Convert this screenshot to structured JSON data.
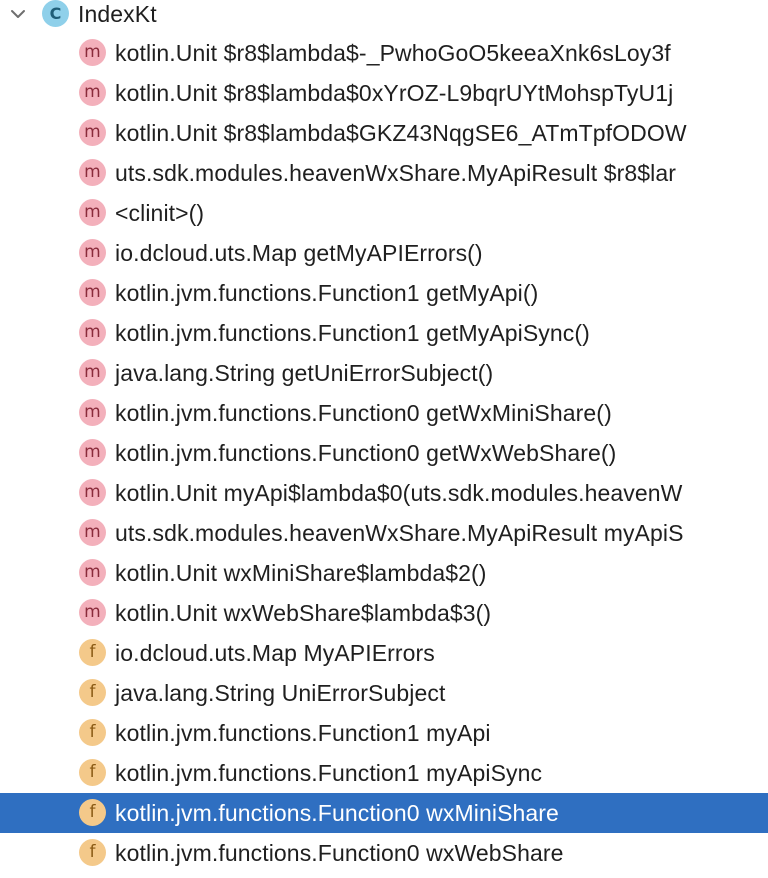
{
  "tree": {
    "root": {
      "label": "IndexKt",
      "icon": "class-icon",
      "icon_letter": "C",
      "expanded": true
    },
    "members": [
      {
        "kind": "method",
        "letter": "m",
        "label": "kotlin.Unit $r8$lambda$-_PwhoGoO5keeaXnk6sLoy3f"
      },
      {
        "kind": "method",
        "letter": "m",
        "label": "kotlin.Unit $r8$lambda$0xYrOZ-L9bqrUYtMohspTyU1j"
      },
      {
        "kind": "method",
        "letter": "m",
        "label": "kotlin.Unit $r8$lambda$GKZ43NqgSE6_ATmTpfODOW"
      },
      {
        "kind": "method",
        "letter": "m",
        "label": "uts.sdk.modules.heavenWxShare.MyApiResult $r8$lar"
      },
      {
        "kind": "method",
        "letter": "m",
        "label": "<clinit>()"
      },
      {
        "kind": "method",
        "letter": "m",
        "label": "io.dcloud.uts.Map getMyAPIErrors()"
      },
      {
        "kind": "method",
        "letter": "m",
        "label": "kotlin.jvm.functions.Function1 getMyApi()"
      },
      {
        "kind": "method",
        "letter": "m",
        "label": "kotlin.jvm.functions.Function1 getMyApiSync()"
      },
      {
        "kind": "method",
        "letter": "m",
        "label": "java.lang.String getUniErrorSubject()"
      },
      {
        "kind": "method",
        "letter": "m",
        "label": "kotlin.jvm.functions.Function0 getWxMiniShare()"
      },
      {
        "kind": "method",
        "letter": "m",
        "label": "kotlin.jvm.functions.Function0 getWxWebShare()"
      },
      {
        "kind": "method",
        "letter": "m",
        "label": "kotlin.Unit myApi$lambda$0(uts.sdk.modules.heavenW"
      },
      {
        "kind": "method",
        "letter": "m",
        "label": "uts.sdk.modules.heavenWxShare.MyApiResult myApiS"
      },
      {
        "kind": "method",
        "letter": "m",
        "label": "kotlin.Unit wxMiniShare$lambda$2()"
      },
      {
        "kind": "method",
        "letter": "m",
        "label": "kotlin.Unit wxWebShare$lambda$3()"
      },
      {
        "kind": "field",
        "letter": "f",
        "label": "io.dcloud.uts.Map MyAPIErrors"
      },
      {
        "kind": "field",
        "letter": "f",
        "label": "java.lang.String UniErrorSubject"
      },
      {
        "kind": "field",
        "letter": "f",
        "label": "kotlin.jvm.functions.Function1 myApi"
      },
      {
        "kind": "field",
        "letter": "f",
        "label": "kotlin.jvm.functions.Function1 myApiSync"
      },
      {
        "kind": "field",
        "letter": "f",
        "label": "kotlin.jvm.functions.Function0 wxMiniShare",
        "selected": true
      },
      {
        "kind": "field",
        "letter": "f",
        "label": "kotlin.jvm.functions.Function0 wxWebShare"
      }
    ]
  },
  "colors": {
    "selection": "#2f6fc1",
    "class_badge": "#8fd0ea",
    "method_badge": "#f3b0bb",
    "field_badge": "#f4c98a"
  }
}
